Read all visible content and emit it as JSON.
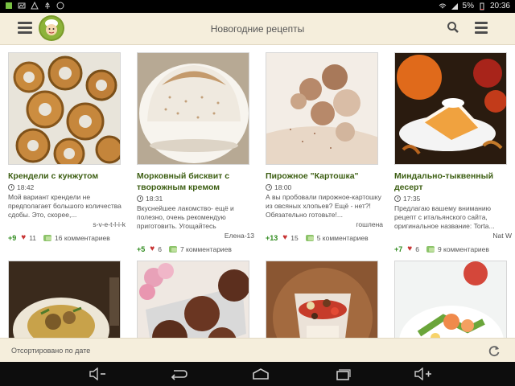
{
  "status_bar": {
    "battery": "5%",
    "time": "20:36",
    "icons": [
      "android-debug-icon",
      "image-icon",
      "warning-icon",
      "usb-icon",
      "viber-icon",
      "wifi-icon",
      "signal-icon",
      "battery-icon"
    ]
  },
  "app_bar": {
    "title": "Новогодние рецепты",
    "icons": [
      "menu-icon",
      "chef-logo-icon",
      "search-icon",
      "more-icon"
    ]
  },
  "recipes": [
    {
      "title": "Крендели с кунжутом",
      "time": "18:42",
      "description": "Мой вариант крендели не предполагает большого количества сдобы. Это, скорее,...",
      "author": "s-v-e-t-l-i-k",
      "score": "+9",
      "likes": "11",
      "comments": "16 комментариев"
    },
    {
      "title": "Морковный бисквит с творожным кремом",
      "time": "18:31",
      "description": "Вкуснейшее лакомство- ещё и полезно, очень рекомендую приготовить. Угощайтесь",
      "author": "Елена-13",
      "score": "+5",
      "likes": "6",
      "comments": "7 комментариев"
    },
    {
      "title": "Пирожное \"Картошка\"",
      "time": "18:00",
      "description": "А вы пробовали пирожное-картошку из овсяных хлопьев? Ещё - нет?! Обязательно готовьте!...",
      "author": "гошлена",
      "score": "+13",
      "likes": "15",
      "comments": "5 комментариев"
    },
    {
      "title": "Миндально-тыквенный десерт",
      "time": "17:35",
      "description": "Предлагаю вашему вниманию рецепт с итальянского сайта, оригинальное название: Torta...",
      "author": "Nat W",
      "score": "+7",
      "likes": "6",
      "comments": "9 комментариев"
    }
  ],
  "sort_bar": {
    "label": "Отсортировано по дате",
    "icon": "refresh-icon"
  },
  "nav_bar": {
    "icons": [
      "volume-down-icon",
      "back-icon",
      "home-icon",
      "recents-icon",
      "volume-up-icon"
    ]
  }
}
